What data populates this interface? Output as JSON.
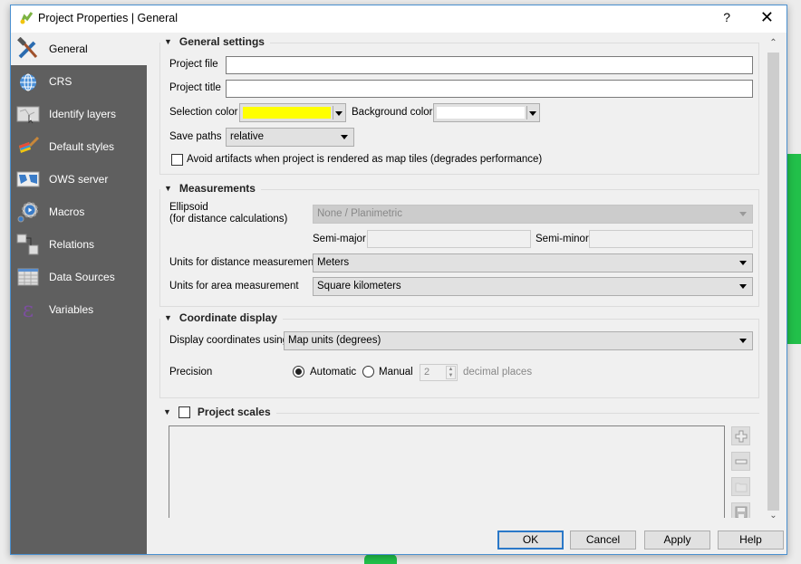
{
  "window": {
    "title": "Project Properties | General",
    "help_label": "?",
    "close_label": "✕"
  },
  "sidebar": {
    "items": [
      {
        "label": "General",
        "icon": "hammer-wrench-icon",
        "active": true
      },
      {
        "label": "CRS",
        "icon": "globe-icon"
      },
      {
        "label": "Identify layers",
        "icon": "identify-map-icon"
      },
      {
        "label": "Default styles",
        "icon": "paintbrush-icon"
      },
      {
        "label": "OWS server",
        "icon": "ows-map-icon"
      },
      {
        "label": "Macros",
        "icon": "gear-play-icon"
      },
      {
        "label": "Relations",
        "icon": "relations-table-icon"
      },
      {
        "label": "Data Sources",
        "icon": "table-icon"
      },
      {
        "label": "Variables",
        "icon": "epsilon-icon"
      }
    ]
  },
  "general_settings": {
    "title": "General settings",
    "project_file_label": "Project file",
    "project_file_value": "",
    "project_title_label": "Project title",
    "project_title_value": "",
    "selection_color_label": "Selection color",
    "selection_color": "#ffff00",
    "background_color_label": "Background color",
    "background_color": "#ffffff",
    "save_paths_label": "Save paths",
    "save_paths_value": "relative",
    "avoid_artifacts_label": "Avoid artifacts when project is rendered as map tiles (degrades performance)",
    "avoid_artifacts_checked": false
  },
  "measurements": {
    "title": "Measurements",
    "ellipsoid_label_line1": "Ellipsoid",
    "ellipsoid_label_line2": "(for distance calculations)",
    "ellipsoid_value": "None / Planimetric",
    "semi_major_label": "Semi-major",
    "semi_major_value": "",
    "semi_minor_label": "Semi-minor",
    "semi_minor_value": "",
    "distance_units_label": "Units for distance measurement",
    "distance_units_value": "Meters",
    "area_units_label": "Units for area measurement",
    "area_units_value": "Square kilometers"
  },
  "coordinate_display": {
    "title": "Coordinate display",
    "display_using_label": "Display coordinates using",
    "display_using_value": "Map units (degrees)",
    "precision_label": "Precision",
    "automatic_label": "Automatic",
    "automatic_selected": true,
    "manual_label": "Manual",
    "manual_selected": false,
    "decimal_value": "2",
    "decimal_places_label": "decimal places"
  },
  "project_scales": {
    "title": "Project scales",
    "checked": false,
    "tools": [
      "add-icon",
      "remove-icon",
      "folder-icon",
      "save-icon"
    ]
  },
  "buttons": {
    "ok": "OK",
    "cancel": "Cancel",
    "apply": "Apply",
    "help": "Help"
  }
}
